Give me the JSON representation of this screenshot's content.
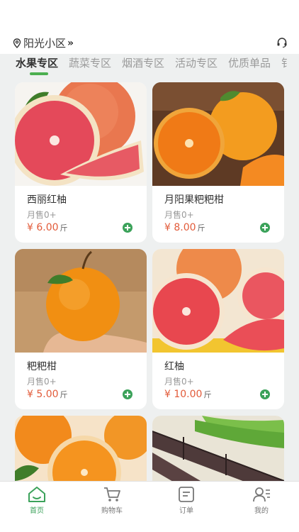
{
  "header": {
    "location": "阳光小区",
    "chevron": "»"
  },
  "tabs": [
    {
      "label": "水果专区"
    },
    {
      "label": "蔬菜专区"
    },
    {
      "label": "烟酒专区"
    },
    {
      "label": "活动专区"
    },
    {
      "label": "优质单品"
    },
    {
      "label": "钅"
    }
  ],
  "products": [
    {
      "name": "西丽红柚",
      "sales": "月售0+",
      "price": "¥ 6.00",
      "unit": "斤"
    },
    {
      "name": "月阳果粑粑柑",
      "sales": "月售0+",
      "price": "¥ 8.00",
      "unit": "斤"
    },
    {
      "name": "粑粑柑",
      "sales": "月售0+",
      "price": "¥ 5.00",
      "unit": "斤"
    },
    {
      "name": "红柚",
      "sales": "月售0+",
      "price": "¥ 10.00",
      "unit": "斤"
    }
  ],
  "nav": [
    {
      "label": "首页",
      "icon": "home-icon"
    },
    {
      "label": "购物车",
      "icon": "cart-icon"
    },
    {
      "label": "订单",
      "icon": "order-icon"
    },
    {
      "label": "我的",
      "icon": "profile-icon"
    }
  ],
  "colors": {
    "accent": "#3ba25a",
    "price": "#e25b3a",
    "background": "#eef0f0"
  }
}
